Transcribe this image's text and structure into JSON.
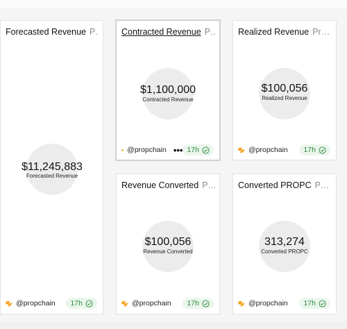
{
  "cards": [
    {
      "key": "forecast",
      "title": "Forecasted Revenue",
      "subtitle": "Prop...",
      "value": "$11,245,883",
      "label": "Forecasted Revenue",
      "handle": "@propchain",
      "age": "17h"
    },
    {
      "key": "contracted",
      "title": "Contracted Revenue",
      "subtitle": "Pro...",
      "value": "$1,100,000",
      "label": "Contracted Revenue",
      "handle": "@propchain",
      "age": "17h",
      "more": "•••"
    },
    {
      "key": "realized",
      "title": "Realized Revenue",
      "subtitle": "Propc...",
      "value": "$100,056",
      "label": "Realized Revenue",
      "handle": "@propchain",
      "age": "17h"
    },
    {
      "key": "converted",
      "title": "Revenue Converted",
      "subtitle": "Prop...",
      "value": "$100,056",
      "label": "Revenue Converted",
      "handle": "@propchain",
      "age": "17h"
    },
    {
      "key": "propc",
      "title": "Converted PROPC",
      "subtitle": "Propc...",
      "value": "313,274",
      "label": "Converted PROPC",
      "handle": "@propchain",
      "age": "17h"
    }
  ],
  "colors": {
    "badge_bg": "#eaf6ec",
    "badge_text": "#2e8b3a",
    "circle": "#ececec",
    "chain_icon": "#f5a524"
  },
  "icons": {
    "chain": "chain-icon",
    "check": "check-circle-icon",
    "more": "more-icon"
  }
}
